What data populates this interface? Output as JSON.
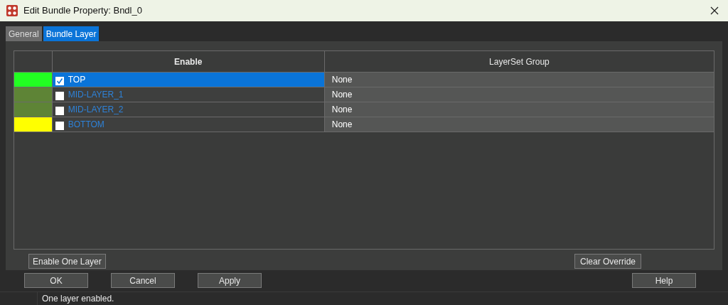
{
  "window": {
    "title": "Edit Bundle Property: Bndl_0"
  },
  "tabs": [
    {
      "label": "General",
      "selected": false
    },
    {
      "label": "Bundle Layer",
      "selected": true
    }
  ],
  "table": {
    "columns": [
      "Enable",
      "LayerSet Group"
    ],
    "rows": [
      {
        "color": "#22ff22",
        "checked": true,
        "selected": true,
        "layer": "TOP",
        "group": "None"
      },
      {
        "color": "#5e8436",
        "checked": false,
        "selected": false,
        "layer": "MID-LAYER_1",
        "group": "None"
      },
      {
        "color": "#5e8436",
        "checked": false,
        "selected": false,
        "layer": "MID-LAYER_2",
        "group": "None"
      },
      {
        "color": "#ffff00",
        "checked": false,
        "selected": false,
        "layer": "BOTTOM",
        "group": "None"
      }
    ]
  },
  "panel_buttons": [
    "Enable One Layer",
    "Clear Override"
  ],
  "dialog_buttons": [
    "OK",
    "Cancel",
    "Apply"
  ],
  "help_button": "Help",
  "status_bar": "One layer enabled."
}
